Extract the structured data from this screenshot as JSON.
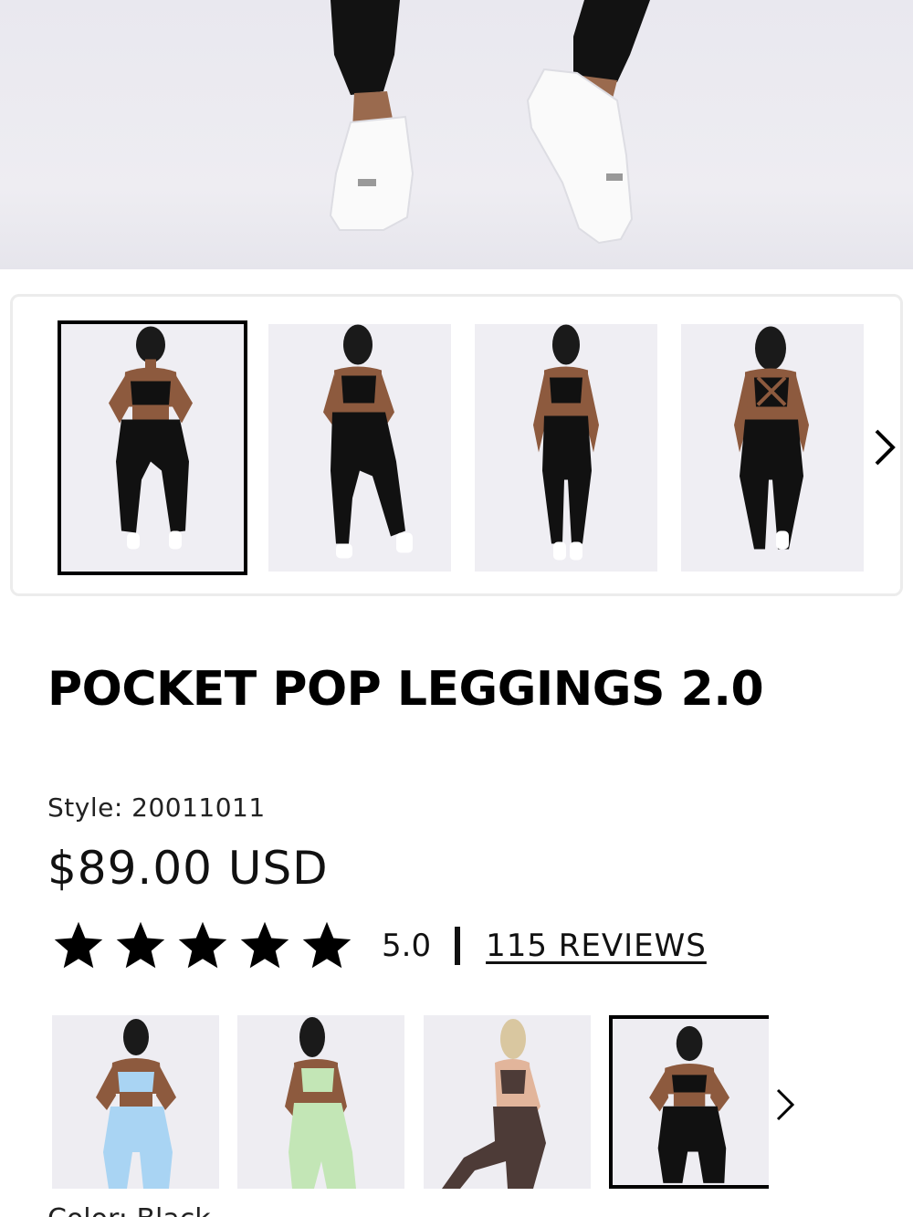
{
  "product": {
    "title": "POCKET POP LEGGINGS 2.0",
    "style_label": "Style: 20011011",
    "price": "$89.00 USD",
    "rating_value": "5.0",
    "rating_stars": 5,
    "reviews_link": "115 REVIEWS",
    "color_label": "Color: Black"
  },
  "gallery": {
    "selected_index": 0,
    "thumbnails": [
      "front",
      "back-side",
      "front-relaxed",
      "back"
    ],
    "next_icon": "chevron-right-icon"
  },
  "swatches": {
    "selected_index": 3,
    "colors": [
      {
        "name": "light-blue",
        "hex": "#a9d4f3"
      },
      {
        "name": "mint-green",
        "hex": "#c3e6b6"
      },
      {
        "name": "chocolate",
        "hex": "#4d3b37"
      },
      {
        "name": "black",
        "hex": "#111111"
      }
    ],
    "next_icon": "chevron-right-icon"
  },
  "colors": {
    "accent": "#000000",
    "border": "#ececec",
    "photo_bg": "#eeedf2"
  }
}
